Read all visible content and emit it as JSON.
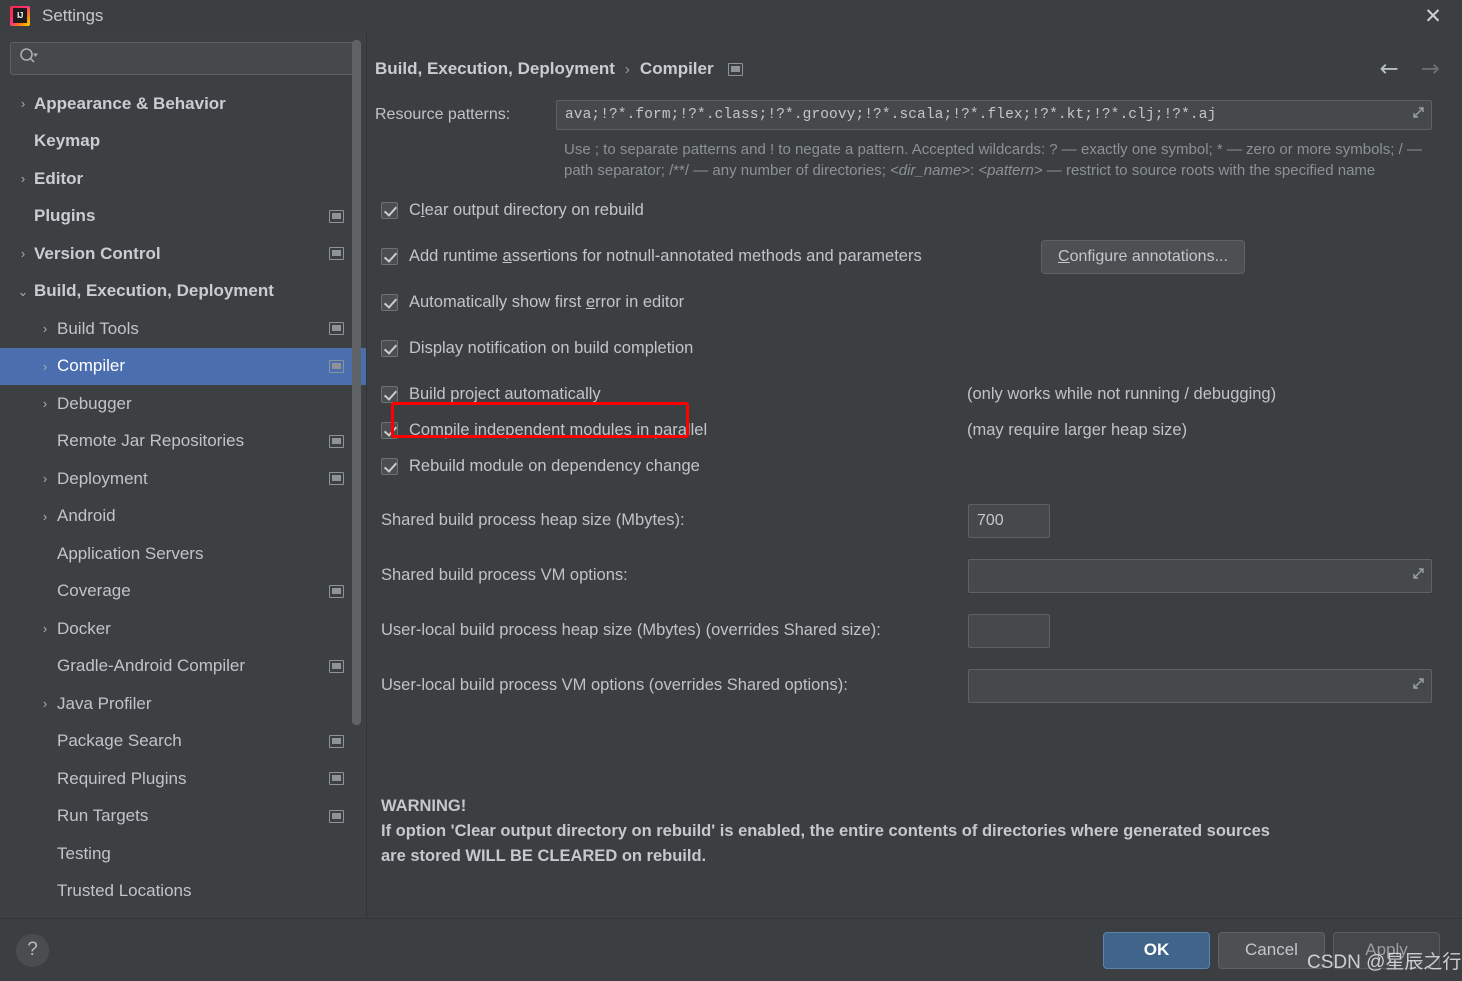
{
  "window": {
    "title": "Settings",
    "logo_icon": "intellij-idea-logo",
    "close_icon": "close-icon"
  },
  "sidebar": {
    "search": {
      "placeholder": "",
      "value": "",
      "icon": "search-icon"
    },
    "items": [
      {
        "label": "Appearance & Behavior",
        "level": 0,
        "arrow": "›",
        "bold": true,
        "badge": false,
        "selected": false
      },
      {
        "label": "Keymap",
        "level": 0,
        "arrow": "",
        "bold": true,
        "badge": false,
        "selected": false
      },
      {
        "label": "Editor",
        "level": 0,
        "arrow": "›",
        "bold": true,
        "badge": false,
        "selected": false
      },
      {
        "label": "Plugins",
        "level": 0,
        "arrow": "",
        "bold": true,
        "badge": true,
        "selected": false
      },
      {
        "label": "Version Control",
        "level": 0,
        "arrow": "›",
        "bold": true,
        "badge": true,
        "selected": false
      },
      {
        "label": "Build, Execution, Deployment",
        "level": 0,
        "arrow": "⌄",
        "bold": true,
        "badge": false,
        "selected": false
      },
      {
        "label": "Build Tools",
        "level": 1,
        "arrow": "›",
        "bold": false,
        "badge": true,
        "selected": false
      },
      {
        "label": "Compiler",
        "level": 1,
        "arrow": "›",
        "bold": false,
        "badge": true,
        "selected": true
      },
      {
        "label": "Debugger",
        "level": 1,
        "arrow": "›",
        "bold": false,
        "badge": false,
        "selected": false
      },
      {
        "label": "Remote Jar Repositories",
        "level": 1,
        "arrow": "",
        "bold": false,
        "badge": true,
        "selected": false
      },
      {
        "label": "Deployment",
        "level": 1,
        "arrow": "›",
        "bold": false,
        "badge": true,
        "selected": false
      },
      {
        "label": "Android",
        "level": 1,
        "arrow": "›",
        "bold": false,
        "badge": false,
        "selected": false
      },
      {
        "label": "Application Servers",
        "level": 1,
        "arrow": "",
        "bold": false,
        "badge": false,
        "selected": false
      },
      {
        "label": "Coverage",
        "level": 1,
        "arrow": "",
        "bold": false,
        "badge": true,
        "selected": false
      },
      {
        "label": "Docker",
        "level": 1,
        "arrow": "›",
        "bold": false,
        "badge": false,
        "selected": false
      },
      {
        "label": "Gradle-Android Compiler",
        "level": 1,
        "arrow": "",
        "bold": false,
        "badge": true,
        "selected": false
      },
      {
        "label": "Java Profiler",
        "level": 1,
        "arrow": "›",
        "bold": false,
        "badge": false,
        "selected": false
      },
      {
        "label": "Package Search",
        "level": 1,
        "arrow": "",
        "bold": false,
        "badge": true,
        "selected": false
      },
      {
        "label": "Required Plugins",
        "level": 1,
        "arrow": "",
        "bold": false,
        "badge": true,
        "selected": false
      },
      {
        "label": "Run Targets",
        "level": 1,
        "arrow": "",
        "bold": false,
        "badge": true,
        "selected": false
      },
      {
        "label": "Testing",
        "level": 1,
        "arrow": "",
        "bold": false,
        "badge": false,
        "selected": false
      },
      {
        "label": "Trusted Locations",
        "level": 1,
        "arrow": "",
        "bold": false,
        "badge": false,
        "selected": false
      }
    ]
  },
  "header": {
    "breadcrumb_parent": "Build, Execution, Deployment",
    "breadcrumb_separator": "›",
    "breadcrumb_current": "Compiler",
    "project_badge_icon": "project-settings-icon",
    "back_arrow": "←",
    "forward_arrow": "→"
  },
  "main": {
    "resource_patterns": {
      "label": "Resource patterns:",
      "value": "ava;!?*.form;!?*.class;!?*.groovy;!?*.scala;!?*.flex;!?*.kt;!?*.clj;!?*.aj",
      "expand_icon": "expand-editor-icon"
    },
    "hint_line1": "Use ; to separate patterns and ! to negate a pattern. Accepted wildcards: ? — exactly one symbol; * — zero or",
    "hint_line2_a": "more symbols; / — path separator; /**/ — any number of directories;  ",
    "hint_line2_italic1": "<dir_name>",
    "hint_line2_b": ": ",
    "hint_line2_italic2": "<pattern>",
    "hint_line2_c": " — restrict to",
    "hint_line3": "source roots with the specified name",
    "checkboxes": [
      {
        "label_pre": "C",
        "label_mnemonic": "l",
        "label_post": "ear output directory on rebuild",
        "checked": true,
        "note": ""
      },
      {
        "label_pre": "Add runtime ",
        "label_mnemonic": "a",
        "label_post": "ssertions for notnull-annotated methods and parameters",
        "checked": true,
        "note": ""
      },
      {
        "label_pre": "Automatically show first ",
        "label_mnemonic": "e",
        "label_post": "rror in editor",
        "checked": true,
        "note": ""
      },
      {
        "label_pre": "Display notification on build completion",
        "label_mnemonic": "",
        "label_post": "",
        "checked": true,
        "note": ""
      },
      {
        "label_pre": "Build project automatically",
        "label_mnemonic": "",
        "label_post": "",
        "checked": true,
        "note": "(only works while not running / debugging)"
      },
      {
        "label_pre": "Compile independent modules in parallel",
        "label_mnemonic": "",
        "label_post": "",
        "checked": true,
        "note": "(may require larger heap size)"
      },
      {
        "label_pre": "Rebuild module on dependency change",
        "label_mnemonic": "",
        "label_post": "",
        "checked": true,
        "note": ""
      }
    ],
    "configure_annotations_button": {
      "label_mnemonic": "C",
      "label_rest": "onfigure annotations..."
    },
    "fields": [
      {
        "label": "Shared build process heap size (Mbytes):",
        "value": "700",
        "type": "number",
        "placeholder": ""
      },
      {
        "label": "Shared build process VM options:",
        "value": "",
        "type": "vm",
        "placeholder": ""
      },
      {
        "label": "User-local build process heap size (Mbytes) (overrides Shared size):",
        "value": "",
        "type": "number",
        "placeholder": ""
      },
      {
        "label": "User-local build process VM options (overrides Shared options):",
        "value": "",
        "type": "vm",
        "placeholder": ""
      }
    ],
    "warning_title": "WARNING!",
    "warning_line1": "If option 'Clear output directory on rebuild' is enabled, the entire contents of directories where generated sources",
    "warning_line2": "are stored WILL BE CLEARED on rebuild."
  },
  "annotation": {
    "color": "#ff0000",
    "target": "Build project automatically"
  },
  "footer": {
    "help_icon": "?",
    "ok_label": "OK",
    "cancel_label": "Cancel",
    "apply_label": "Apply"
  },
  "watermark": "CSDN @星辰之行"
}
